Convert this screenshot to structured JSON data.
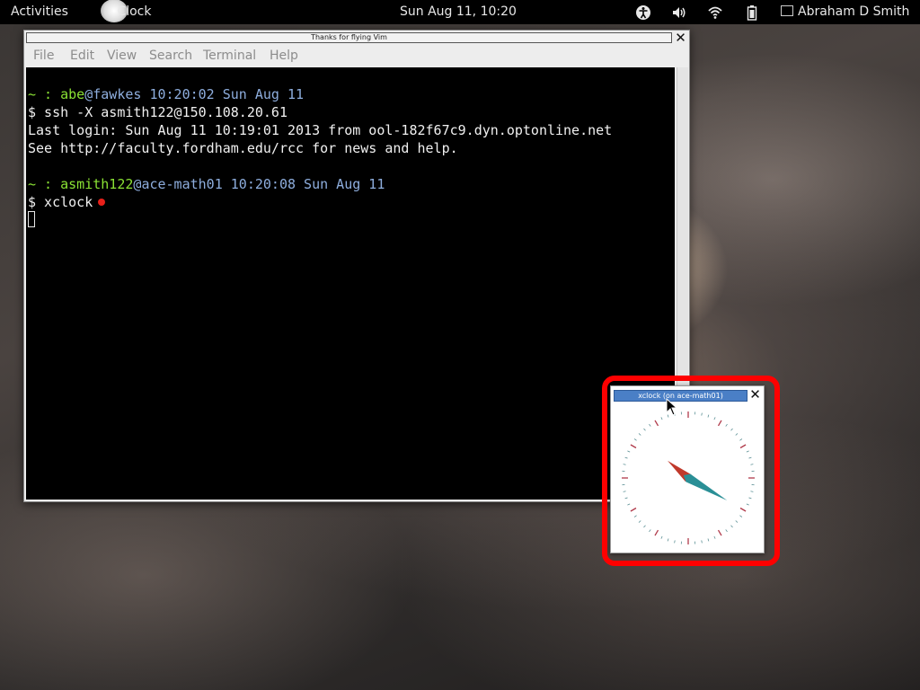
{
  "topbar": {
    "activities": "Activities",
    "app_label": "Clock",
    "clock": "Sun Aug 11, 10:20",
    "user": "Abraham D Smith",
    "icons": [
      "accessibility-icon",
      "volume-icon",
      "wifi-icon",
      "battery-icon",
      "chat-icon"
    ]
  },
  "terminal": {
    "title": "Thanks for flying Vim",
    "menu": [
      "File",
      "Edit",
      "View",
      "Search",
      "Terminal",
      "Help"
    ],
    "prompt1": {
      "prefix": "~ : ",
      "user": "abe",
      "at": "@",
      "host": "fawkes",
      "time": " 10:20:02 Sun Aug 11"
    },
    "cmd1": "$ ssh -X asmith122@150.108.20.61",
    "output": [
      "Last login: Sun Aug 11 10:19:01 2013 from ool-182f67c9.dyn.optonline.net",
      "See http://faculty.fordham.edu/rcc for news and help."
    ],
    "prompt2": {
      "prefix": "~ : ",
      "user": "asmith122",
      "at": "@",
      "host": "ace-math01",
      "time": " 10:20:08 Sun Aug 11"
    },
    "cmd2": "$ xclock"
  },
  "xclock": {
    "title": "xclock (on ace-math01)",
    "time": {
      "hour": 10,
      "minute": 20
    },
    "colors": {
      "hour_hand": "#c0392b",
      "minute_hand": "#2a8f96",
      "ticks": "#b03a4a"
    }
  }
}
